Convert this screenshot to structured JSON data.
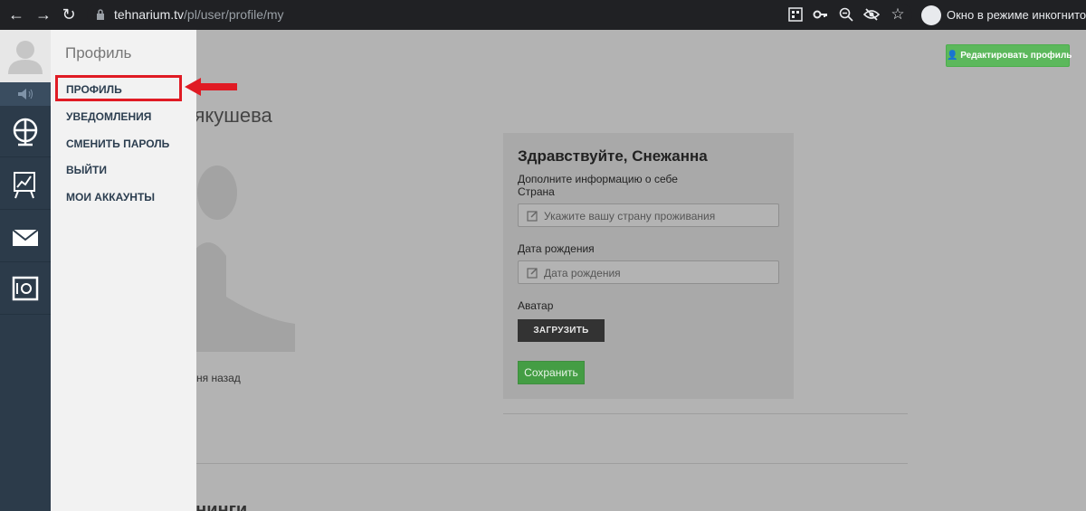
{
  "browser": {
    "url_host": "tehnarium.tv",
    "url_path": "/pl/user/profile/my",
    "incognito_label": "Окно в режиме инкогнито"
  },
  "menu": {
    "title": "Профиль",
    "items": [
      {
        "label": "ПРОФИЛЬ",
        "highlighted": true
      },
      {
        "label": "УВЕДОМЛЕНИЯ"
      },
      {
        "label": "СМЕНИТЬ ПАРОЛЬ"
      },
      {
        "label": "ВЫЙТИ"
      },
      {
        "label": "МОИ АККАУНТЫ"
      }
    ]
  },
  "rail": {
    "icons": [
      "user-avatar-icon",
      "speaker-icon",
      "globe-icon",
      "chart-board-icon",
      "mail-icon",
      "safe-icon"
    ]
  },
  "profile": {
    "edit_button": "Редактировать профиль",
    "name_fragment": "Лякушева",
    "last_seen_fragment": "дня назад",
    "section_fragment": "енинги"
  },
  "card": {
    "greeting": "Здравствуйте, Снежанна",
    "subtitle": "Дополните информацию о себе",
    "country_label": "Страна",
    "country_placeholder": "Укажите вашу страну проживания",
    "birth_label": "Дата рождения",
    "birth_placeholder": "Дата рождения",
    "avatar_label": "Аватар",
    "upload_button": "ЗАГРУЗИТЬ",
    "save_button": "Сохранить"
  },
  "colors": {
    "rail": "#2c3b4a",
    "highlight": "#e01b24",
    "green": "#5cb85c"
  }
}
